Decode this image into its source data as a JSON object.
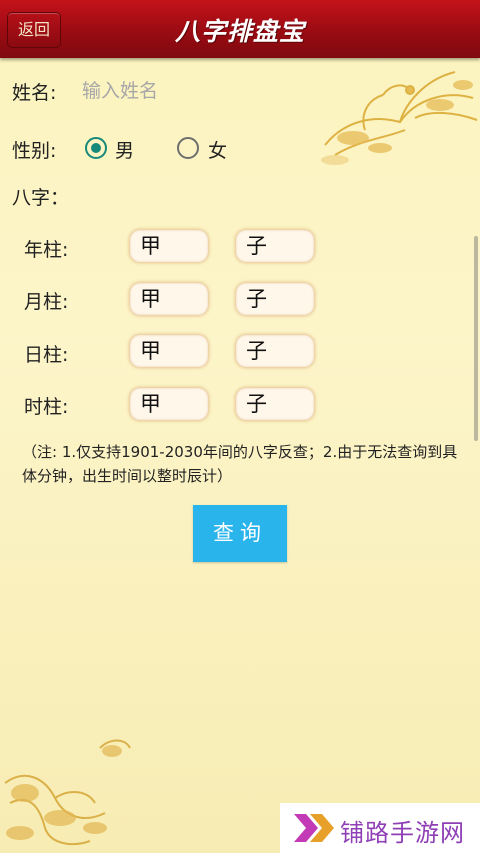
{
  "header": {
    "back_label": "返回",
    "title": "八字排盘宝"
  },
  "form": {
    "name_label": "姓名:",
    "name_placeholder": "输入姓名",
    "name_value": "",
    "gender_label": "性别:",
    "gender_options": [
      {
        "label": "男",
        "selected": true
      },
      {
        "label": "女",
        "selected": false
      }
    ],
    "bazi_label": "八字："
  },
  "pillars": [
    {
      "label": "年柱:",
      "stem": "甲",
      "branch": "子"
    },
    {
      "label": "月柱:",
      "stem": "甲",
      "branch": "子"
    },
    {
      "label": "日柱:",
      "stem": "甲",
      "branch": "子"
    },
    {
      "label": "时柱:",
      "stem": "甲",
      "branch": "子"
    }
  ],
  "note": "（注: 1.仅支持1901-2030年间的八字反查；2.由于无法查询到具体分钟，出生时间以整时辰计）",
  "query_button": "查询",
  "watermark": {
    "text": "铺路手游网"
  },
  "colors": {
    "title_bar": "#9a0b12",
    "background": "#fbf3bd",
    "radio_accent": "#17897a",
    "query_button": "#29b4ec",
    "watermark_text": "#8f3fb5"
  },
  "icons": {
    "back": "back-button",
    "phoenix": "phoenix-ornament-icon",
    "dragon": "dragon-ornament-icon",
    "watermark_logo": "double-chevron-logo-icon"
  }
}
